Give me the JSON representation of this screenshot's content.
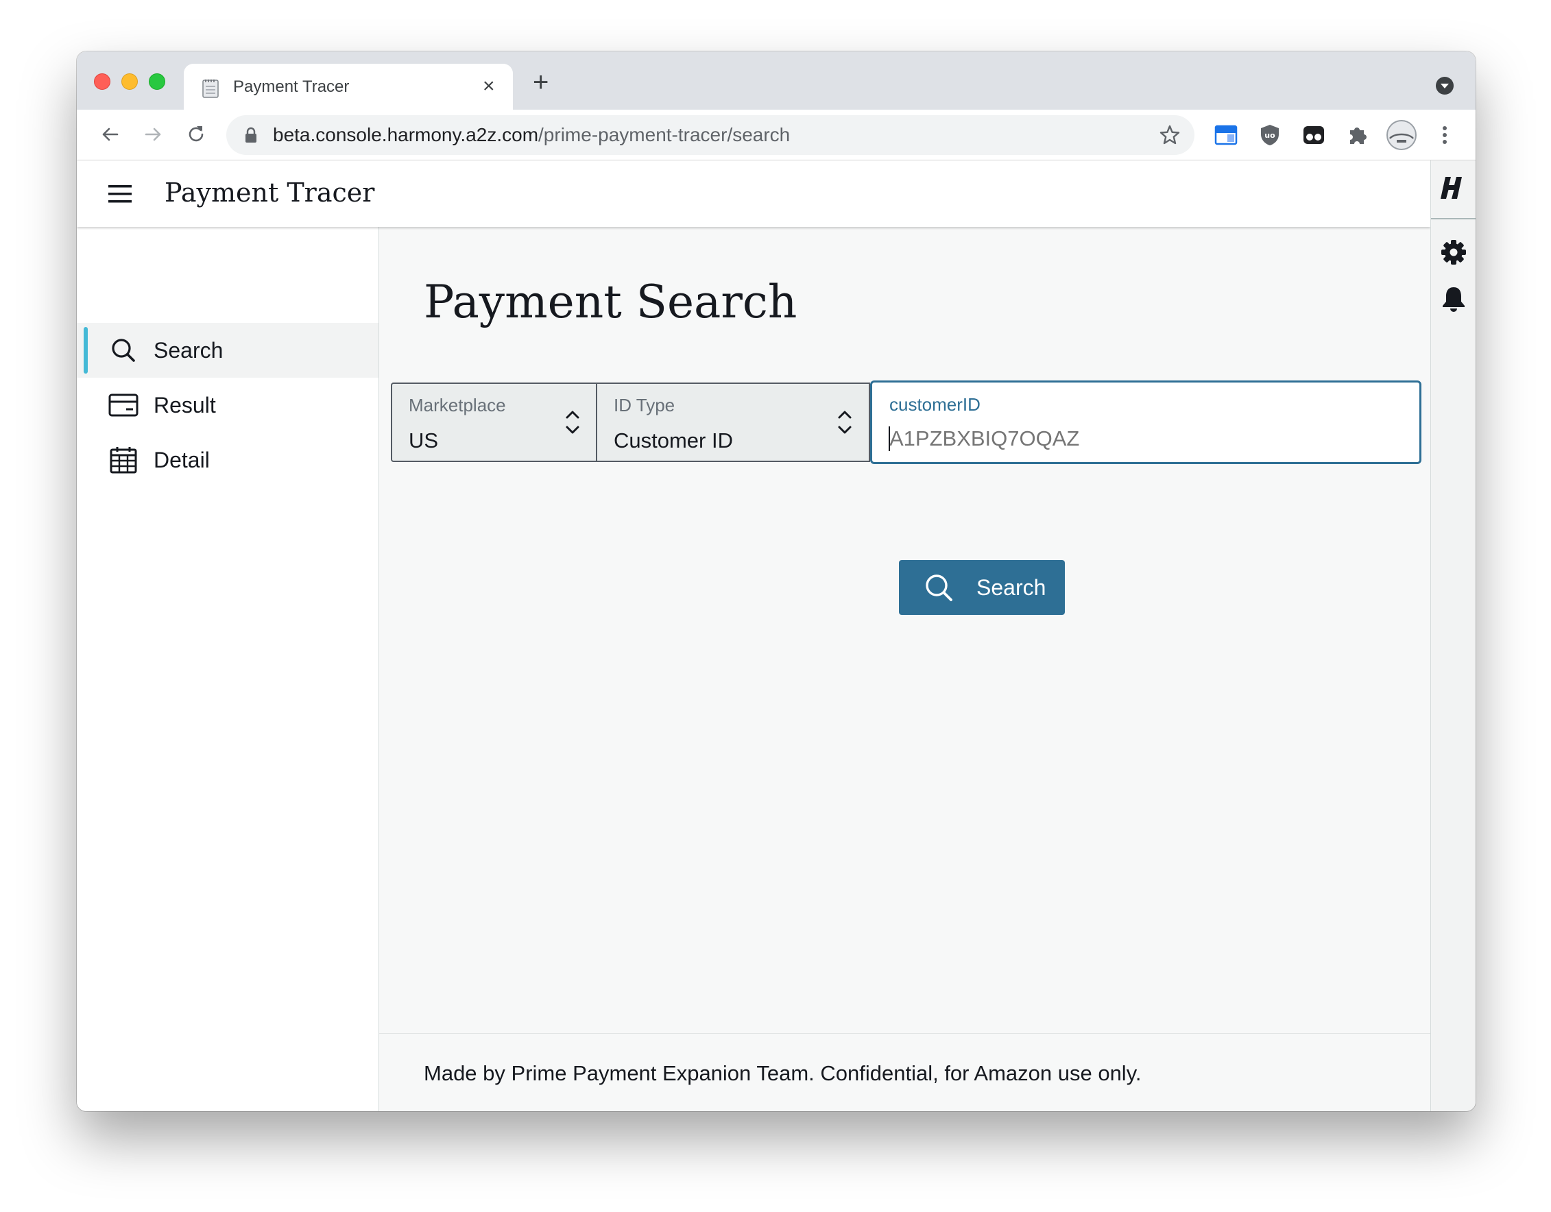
{
  "browser": {
    "tab_title": "Payment Tracer",
    "new_tab_glyph": "+",
    "close_glyph": "×",
    "url_host": "beta.console.harmony.a2z.com",
    "url_path": "/prime-payment-tracer/search"
  },
  "app": {
    "title": "Payment Tracer"
  },
  "sidebar": {
    "items": [
      {
        "label": "Search",
        "icon": "search-icon",
        "active": true
      },
      {
        "label": "Result",
        "icon": "card-icon",
        "active": false
      },
      {
        "label": "Detail",
        "icon": "calendar-icon",
        "active": false
      }
    ]
  },
  "main": {
    "page_title": "Payment Search",
    "marketplace": {
      "label": "Marketplace",
      "value": "US"
    },
    "id_type": {
      "label": "ID Type",
      "value": "Customer ID"
    },
    "id_input": {
      "label": "customerID",
      "placeholder": "A1PZBXBIQ7OQAZ",
      "value": ""
    },
    "search_button": "Search",
    "footer": "Made by Prime Payment Expanion Team. Confidential, for Amazon use only."
  },
  "colors": {
    "accent": "#2e6f95",
    "active_indicator": "#44b9d6",
    "text": "#16191f"
  }
}
